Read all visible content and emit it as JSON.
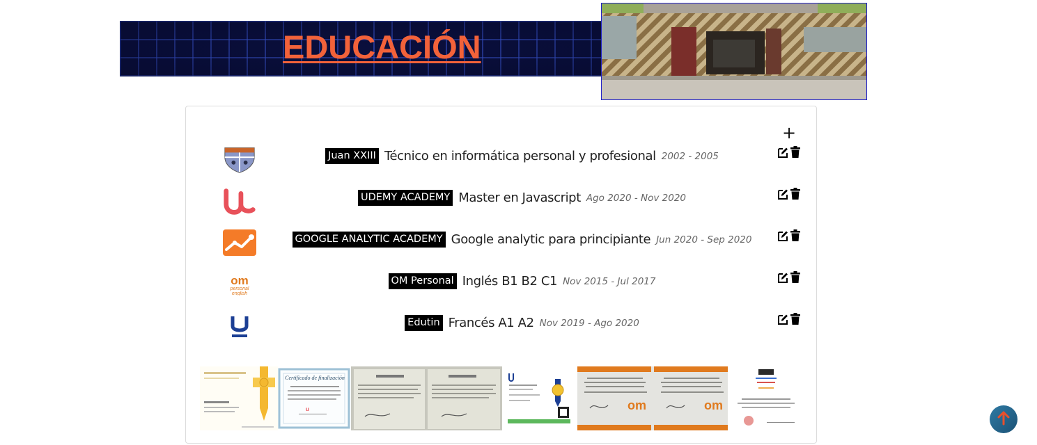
{
  "header": {
    "title": "EDUCACIÓN"
  },
  "education": {
    "add_label": "+",
    "items": [
      {
        "institution": "Juan XXIII",
        "course": "Técnico en informática personal y profesional",
        "dates": "2002 - 2005",
        "logo": "juan-xxiii-shield-icon"
      },
      {
        "institution": "UDEMY ACADEMY",
        "course": "Master en Javascript",
        "dates": "Ago 2020 - Nov 2020",
        "logo": "udemy-icon"
      },
      {
        "institution": "GOOGLE ANALYTIC ACADEMY",
        "course": "Google analytic para principiante",
        "dates": "Jun 2020 - Sep 2020",
        "logo": "google-analytics-icon"
      },
      {
        "institution": "OM Personal",
        "course": "Inglés B1 B2 C1",
        "dates": "Nov 2015 - Jul 2017",
        "logo": "om-personal-icon"
      },
      {
        "institution": "Edutin",
        "course": "Francés A1 A2",
        "dates": "Nov 2019 - Ago 2020",
        "logo": "edutin-icon"
      }
    ]
  },
  "certificates": {
    "finalizacion_title": "Certificado de finalización"
  },
  "colors": {
    "banner_background": "#0a0f3d",
    "banner_title": "#f2623a",
    "badge_background": "#000000",
    "scroll_button": "#2f7aa3",
    "scroll_arrow": "#e8502c"
  }
}
